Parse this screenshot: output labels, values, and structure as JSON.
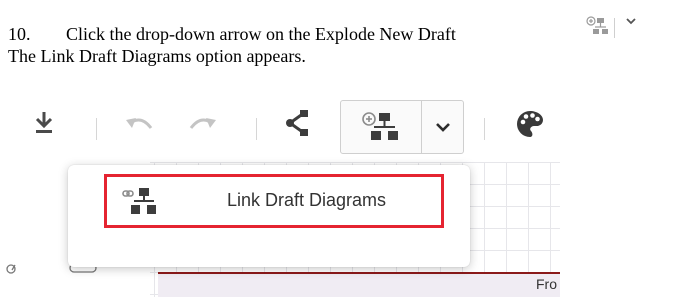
{
  "instruction": {
    "step_number": "10.",
    "step_text": "Click the drop-down arrow on the Explode New Draft",
    "result_text": "The Link Draft Diagrams option appears."
  },
  "icons": {
    "download": "download-icon",
    "undo": "undo-icon",
    "redo": "redo-icon",
    "share": "share-icon",
    "explode": "explode-new-draft-icon",
    "chevron": "chevron-down-icon",
    "palette": "palette-icon",
    "link_diagram": "link-draft-diagram-icon"
  },
  "menu": {
    "items": [
      {
        "label": "Link Draft Diagrams"
      }
    ]
  },
  "canvas": {
    "partial_text": "Fro"
  },
  "colors": {
    "highlight": "#e52431",
    "diagram_border": "#8b1a1a"
  }
}
